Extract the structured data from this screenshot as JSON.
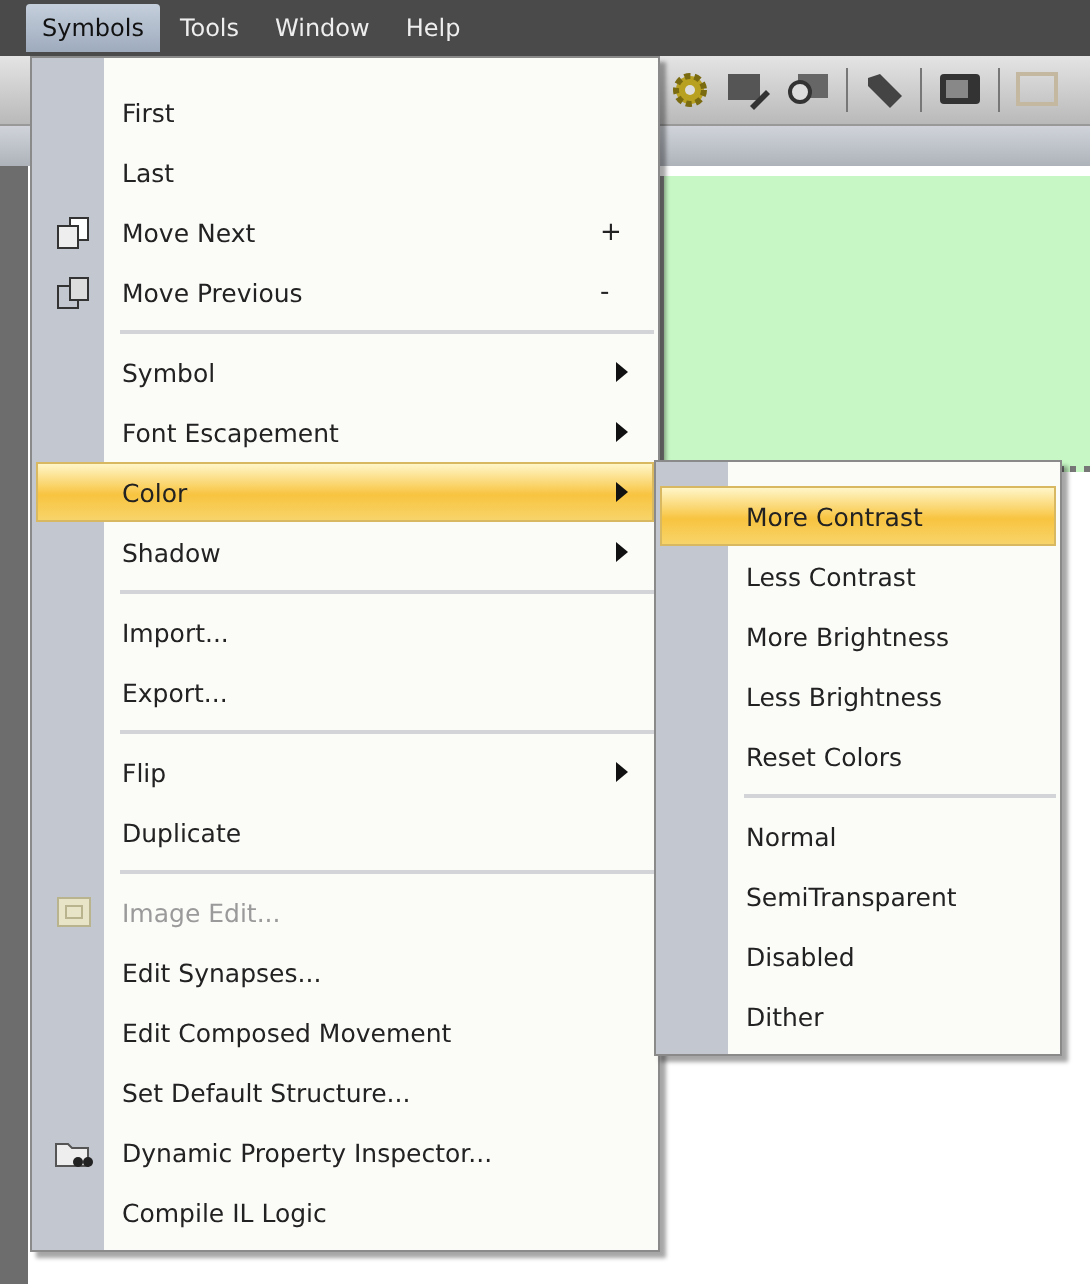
{
  "menu_bar": [
    {
      "label": "Symbols",
      "selected": true
    },
    {
      "label": "Tools",
      "selected": false
    },
    {
      "label": "Window",
      "selected": false
    },
    {
      "label": "Help",
      "selected": false
    }
  ],
  "menu": {
    "items": [
      {
        "kind": "item",
        "label": "First",
        "selected": false
      },
      {
        "kind": "item",
        "label": "Last",
        "selected": false
      },
      {
        "kind": "item",
        "label": "Move Next",
        "shortcut": "+",
        "has_icon": true,
        "selected": false
      },
      {
        "kind": "item",
        "label": "Move Previous",
        "shortcut": "-",
        "has_icon": true,
        "selected": false
      },
      {
        "kind": "separator"
      },
      {
        "kind": "item",
        "label": "Symbol",
        "has_submenu": true,
        "selected": false
      },
      {
        "kind": "item",
        "label": "Font Escapement",
        "has_submenu": true,
        "selected": false
      },
      {
        "kind": "item",
        "label": "Color",
        "has_submenu": true,
        "selected": true
      },
      {
        "kind": "item",
        "label": "Shadow",
        "has_submenu": true,
        "selected": false
      },
      {
        "kind": "separator"
      },
      {
        "kind": "item",
        "label": "Import...",
        "selected": false
      },
      {
        "kind": "item",
        "label": "Export...",
        "selected": false
      },
      {
        "kind": "separator"
      },
      {
        "kind": "item",
        "label": "Flip",
        "has_submenu": true,
        "selected": false
      },
      {
        "kind": "item",
        "label": "Duplicate",
        "selected": false
      },
      {
        "kind": "separator"
      },
      {
        "kind": "item",
        "label": "Image Edit...",
        "has_icon": true,
        "disabled": true,
        "selected": false
      },
      {
        "kind": "item",
        "label": "Edit Synapses...",
        "selected": false
      },
      {
        "kind": "item",
        "label": "Edit Composed Movement",
        "selected": false
      },
      {
        "kind": "item",
        "label": "Set Default Structure...",
        "selected": false
      },
      {
        "kind": "item",
        "label": "Dynamic Property Inspector...",
        "has_icon": true,
        "selected": false
      },
      {
        "kind": "item",
        "label": "Compile IL Logic",
        "selected": false
      }
    ]
  },
  "submenu": {
    "items": [
      {
        "kind": "item",
        "label": "More Contrast",
        "selected": true
      },
      {
        "kind": "item",
        "label": "Less Contrast",
        "selected": false
      },
      {
        "kind": "item",
        "label": "More Brightness",
        "selected": false
      },
      {
        "kind": "item",
        "label": "Less Brightness",
        "selected": false
      },
      {
        "kind": "item",
        "label": "Reset Colors",
        "selected": false
      },
      {
        "kind": "separator"
      },
      {
        "kind": "item",
        "label": "Normal",
        "selected": false
      },
      {
        "kind": "item",
        "label": "SemiTransparent",
        "selected": false
      },
      {
        "kind": "item",
        "label": "Disabled",
        "selected": false
      },
      {
        "kind": "item",
        "label": "Dither",
        "selected": false
      }
    ]
  }
}
